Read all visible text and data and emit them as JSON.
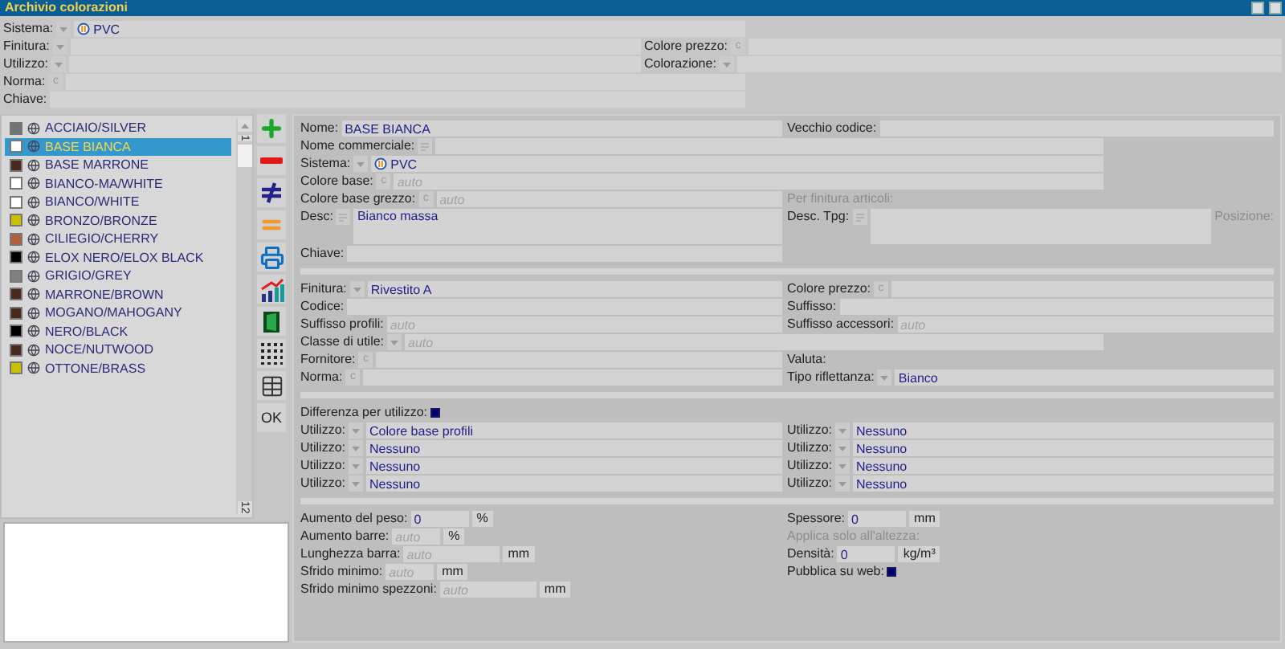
{
  "window": {
    "title": "Archivio colorazioni"
  },
  "filters": [
    {
      "fields": [
        {
          "kind": "system",
          "label": "Sistema:",
          "control": {
            "kind": "dropdown"
          },
          "value": "PVC"
        }
      ]
    },
    {
      "fields": [
        {
          "kind": "text",
          "label": "Finitura:",
          "control": {
            "kind": "dropdown"
          }
        },
        {
          "kind": "text",
          "label": "Colore prezzo:",
          "control": {
            "kind": "code",
            "text": "c"
          }
        }
      ]
    },
    {
      "fields": [
        {
          "kind": "text",
          "label": "Utilizzo:",
          "control": {
            "kind": "dropdown"
          }
        },
        {
          "kind": "text",
          "label": "Colorazione:",
          "control": {
            "kind": "dropdown"
          }
        }
      ]
    },
    {
      "fields": [
        {
          "kind": "text",
          "label": "Norma:",
          "control": {
            "kind": "code",
            "text": "c"
          }
        }
      ]
    },
    {
      "fields": [
        {
          "kind": "text",
          "label": "Chiave:"
        }
      ]
    }
  ],
  "list": {
    "items": [
      {
        "name": "ACCIAIO/SILVER",
        "color": "#6f7575",
        "selected": false
      },
      {
        "name": "BASE BIANCA",
        "color": "#ffffff",
        "selected": true
      },
      {
        "name": "BASE MARRONE",
        "color": "#4a2a1c",
        "selected": false
      },
      {
        "name": "BIANCO-MA/WHITE",
        "color": "#ffffff",
        "selected": false
      },
      {
        "name": "BIANCO/WHITE",
        "color": "#ffffff",
        "selected": false
      },
      {
        "name": "BRONZO/BRONZE",
        "color": "#c8c000",
        "selected": false
      },
      {
        "name": "CILIEGIO/CHERRY",
        "color": "#b0603a",
        "selected": false
      },
      {
        "name": "ELOX NERO/ELOX BLACK",
        "color": "#000000",
        "selected": false
      },
      {
        "name": "GRIGIO/GREY",
        "color": "#808080",
        "selected": false
      },
      {
        "name": "MARRONE/BROWN",
        "color": "#4a2a1c",
        "selected": false
      },
      {
        "name": "MOGANO/MAHOGANY",
        "color": "#46281c",
        "selected": false
      },
      {
        "name": "NERO/BLACK",
        "color": "#000000",
        "selected": false
      },
      {
        "name": "NOCE/NUTWOOD",
        "color": "#4a2a1c",
        "selected": false
      },
      {
        "name": "OTTONE/BRASS",
        "color": "#c8c000",
        "selected": false
      }
    ],
    "scroll_labels": [
      "1",
      "12"
    ]
  },
  "toolbar": [
    {
      "kind": "add"
    },
    {
      "kind": "remove"
    },
    {
      "kind": "not-equal"
    },
    {
      "kind": "equal"
    },
    {
      "kind": "print"
    },
    {
      "kind": "chart"
    },
    {
      "kind": "door"
    },
    {
      "kind": "grid"
    },
    {
      "kind": "table"
    },
    {
      "kind": "ok",
      "label": "OK"
    }
  ],
  "form": {
    "sections": [
      {
        "rows": [
          {
            "left": [
              {
                "kind": "text",
                "label": "Nome:",
                "value": "BASE BIANCA"
              }
            ],
            "right": [
              {
                "kind": "text",
                "label": "Vecchio codice:"
              }
            ]
          },
          {
            "wide": [
              {
                "kind": "text",
                "label": "Nome commerciale:",
                "control": {
                  "kind": "memo"
                }
              }
            ]
          },
          {
            "wide": [
              {
                "kind": "system",
                "label": "Sistema:",
                "control": {
                  "kind": "dropdown"
                },
                "value": "PVC"
              }
            ]
          },
          {
            "wide": [
              {
                "kind": "text",
                "label": "Colore base:",
                "control": {
                  "kind": "code",
                  "text": "c"
                },
                "placeholder": "auto"
              }
            ]
          },
          {
            "left": [
              {
                "kind": "text",
                "label": "Colore base grezzo:",
                "control": {
                  "kind": "code",
                  "text": "c"
                },
                "placeholder": "auto"
              }
            ],
            "right": [
              {
                "kind": "label",
                "label": "Per finitura articoli:",
                "disabled": true
              }
            ]
          },
          {
            "left": [
              {
                "kind": "textarea",
                "label": "Desc:",
                "control": {
                  "kind": "memo"
                },
                "value": "Bianco massa"
              }
            ],
            "right": [
              {
                "kind": "textarea",
                "label": "Desc. Tpg:",
                "control": {
                  "kind": "memo"
                }
              },
              {
                "kind": "label",
                "label": "Posizione:",
                "disabled": true
              }
            ]
          },
          {
            "left": [
              {
                "kind": "text",
                "label": "Chiave:"
              }
            ]
          }
        ]
      },
      {
        "rows": [
          {
            "left": [
              {
                "kind": "text",
                "label": "Finitura:",
                "control": {
                  "kind": "dropdown"
                },
                "value": "Rivestito A"
              }
            ],
            "right": [
              {
                "kind": "text",
                "label": "Colore prezzo:",
                "control": {
                  "kind": "code",
                  "text": "c"
                }
              }
            ]
          },
          {
            "left": [
              {
                "kind": "text",
                "label": "Codice:"
              }
            ],
            "right": [
              {
                "kind": "text",
                "label": "Suffisso:"
              }
            ]
          },
          {
            "left": [
              {
                "kind": "text",
                "label": "Suffisso profili:",
                "placeholder": "auto"
              }
            ],
            "right": [
              {
                "kind": "text",
                "label": "Suffisso accessori:",
                "placeholder": "auto"
              }
            ]
          },
          {
            "wide": [
              {
                "kind": "text",
                "label": "Classe di utile:",
                "control": {
                  "kind": "dropdown"
                },
                "placeholder": "auto"
              }
            ]
          },
          {
            "left": [
              {
                "kind": "text",
                "label": "Fornitore:",
                "control": {
                  "kind": "code",
                  "text": "c"
                }
              }
            ],
            "right": [
              {
                "kind": "label",
                "label": "Valuta:",
                "disabled": false
              }
            ]
          },
          {
            "left": [
              {
                "kind": "text",
                "label": "Norma:",
                "control": {
                  "kind": "code",
                  "text": "c"
                }
              }
            ],
            "right": [
              {
                "kind": "text",
                "label": "Tipo riflettanza:",
                "control": {
                  "kind": "dropdown"
                },
                "value": "Bianco"
              }
            ]
          }
        ]
      },
      {
        "rows": [
          {
            "left": [
              {
                "kind": "check",
                "label": "Differenza per utilizzo:",
                "checked": true
              }
            ]
          },
          {
            "left": [
              {
                "kind": "text",
                "label": "Utilizzo:",
                "control": {
                  "kind": "dropdown"
                },
                "value": "Colore base profili"
              }
            ],
            "right": [
              {
                "kind": "text",
                "label": "Utilizzo:",
                "control": {
                  "kind": "dropdown"
                },
                "value": "Nessuno"
              }
            ]
          },
          {
            "left": [
              {
                "kind": "text",
                "label": "Utilizzo:",
                "control": {
                  "kind": "dropdown"
                },
                "value": "Nessuno"
              }
            ],
            "right": [
              {
                "kind": "text",
                "label": "Utilizzo:",
                "control": {
                  "kind": "dropdown"
                },
                "value": "Nessuno"
              }
            ]
          },
          {
            "left": [
              {
                "kind": "text",
                "label": "Utilizzo:",
                "control": {
                  "kind": "dropdown"
                },
                "value": "Nessuno"
              }
            ],
            "right": [
              {
                "kind": "text",
                "label": "Utilizzo:",
                "control": {
                  "kind": "dropdown"
                },
                "value": "Nessuno"
              }
            ]
          },
          {
            "left": [
              {
                "kind": "text",
                "label": "Utilizzo:",
                "control": {
                  "kind": "dropdown"
                },
                "value": "Nessuno"
              }
            ],
            "right": [
              {
                "kind": "text",
                "label": "Utilizzo:",
                "control": {
                  "kind": "dropdown"
                },
                "value": "Nessuno"
              }
            ]
          }
        ]
      },
      {
        "rows": [
          {
            "left": [
              {
                "kind": "measure",
                "label": "Aumento del peso:",
                "value": "0",
                "unit": "%"
              }
            ],
            "right": [
              {
                "kind": "measure",
                "label": "Spessore:",
                "value": "0",
                "unit": "mm"
              }
            ]
          },
          {
            "left": [
              {
                "kind": "measure",
                "label": "Aumento barre:",
                "placeholder": "auto",
                "unit": "%"
              }
            ],
            "right": [
              {
                "kind": "label",
                "label": "Applica solo all'altezza:",
                "disabled": true
              }
            ]
          },
          {
            "left": [
              {
                "kind": "measure",
                "label": "Lunghezza barra:",
                "placeholder": "auto",
                "unit": "mm"
              }
            ],
            "right": [
              {
                "kind": "measure",
                "label": "Densità:",
                "value": "0",
                "unit": "kg/m³"
              }
            ]
          },
          {
            "left": [
              {
                "kind": "measure",
                "label": "Sfrido minimo:",
                "placeholder": "auto",
                "unit": "mm"
              }
            ],
            "right": [
              {
                "kind": "check",
                "label": "Pubblica su web:",
                "checked": true
              }
            ]
          },
          {
            "left": [
              {
                "kind": "measure",
                "label": "Sfrido minimo spezzoni:",
                "placeholder": "auto",
                "unit": "mm"
              }
            ]
          }
        ]
      }
    ]
  }
}
